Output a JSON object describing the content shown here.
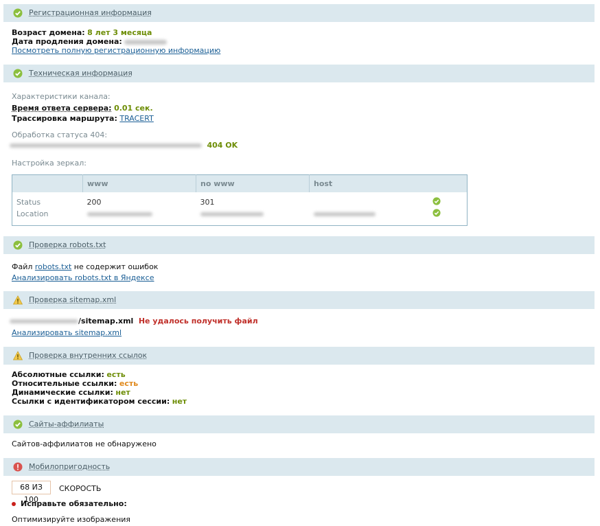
{
  "registration": {
    "title": "Регистрационная информация",
    "age_label": "Возраст домена:",
    "age_value": "8 лет 3 месяца",
    "renew_label": "Дата продления домена:",
    "full_info_link": "Посмотреть полную регистрационную информацию"
  },
  "technical": {
    "title": "Техническая информация",
    "channel_label": "Характеристики канала:",
    "response_label": "Время ответа сервера:",
    "response_value": "0.01 сек.",
    "trace_label": "Трассировка маршрута:",
    "trace_link": "TRACERT",
    "status404_label": "Обработка статуса 404:",
    "status404_value": "404 OK",
    "mirrors_label": "Настройка зеркал:",
    "mirror_table": {
      "headers": [
        "www",
        "no www",
        "host"
      ],
      "rows": [
        {
          "name": "Status",
          "www": "200",
          "nowww": "301"
        },
        {
          "name": "Location"
        }
      ]
    }
  },
  "robots": {
    "title": "Проверка robots.txt",
    "text_prefix": "Файл",
    "file_link": "robots.txt",
    "text_suffix": "не содержит ошибок",
    "analyze_link": "Анализировать robots.txt в Яндексе"
  },
  "sitemap": {
    "title": "Проверка sitemap.xml",
    "file": "/sitemap.xml",
    "error": "Не удалось получить файл",
    "analyze_link": "Анализировать sitemap.xml"
  },
  "internal_links": {
    "title": "Проверка внутренних ссылок",
    "abs_label": "Абсолютные ссылки:",
    "abs_value": "есть",
    "rel_label": "Относительные ссылки:",
    "rel_value": "есть",
    "dyn_label": "Динамические ссылки:",
    "dyn_value": "нет",
    "session_label": "Ссылки с идентификатором сессии:",
    "session_value": "нет"
  },
  "affiliates": {
    "title": "Сайты-аффилиаты",
    "text": "Сайтов-аффилиатов не обнаружено"
  },
  "mobile": {
    "title": "Мобилопригодность",
    "score": "68 ИЗ 100",
    "speed_label": "СКОРОСТЬ",
    "must_fix": "Исправьте обязательно:",
    "optimize": "Оптимизируйте изображения"
  },
  "colors": {
    "header_bg": "#dbe8ee",
    "ok_green": "#6d8d06",
    "error_red": "#c0302a",
    "link_blue": "#1a5e95"
  }
}
